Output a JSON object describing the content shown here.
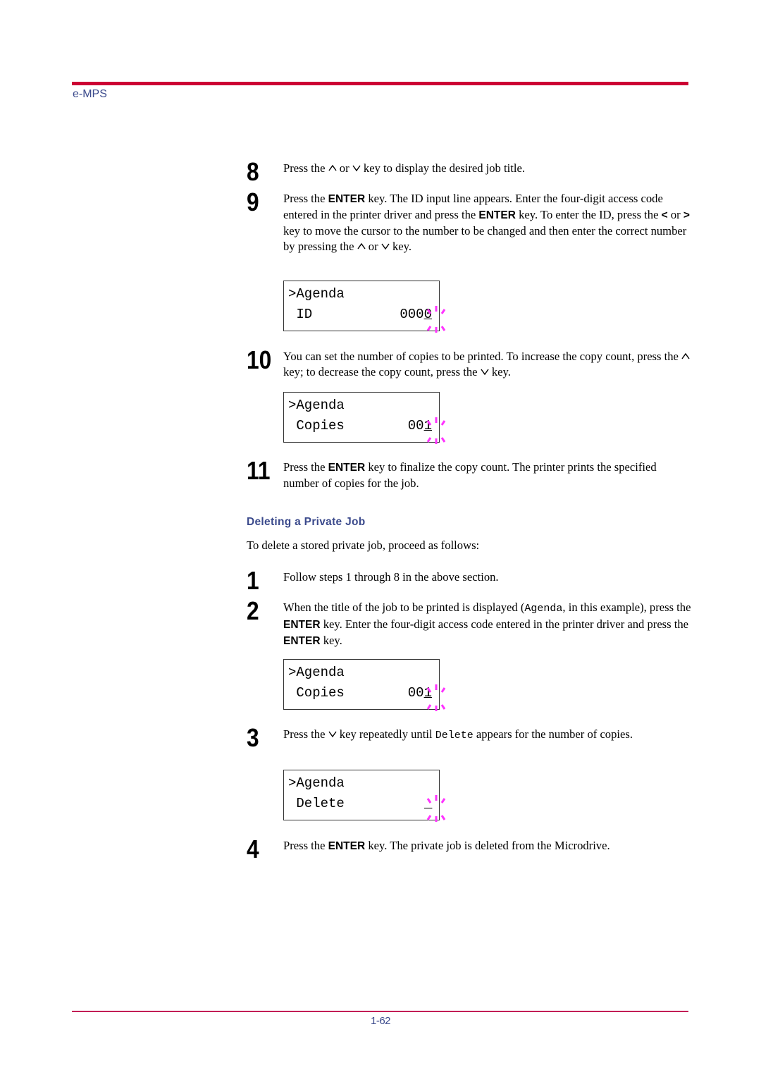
{
  "header": {
    "label": "e-MPS",
    "rule_color": "#cc0033"
  },
  "footer": {
    "page_number": "1-62",
    "rule_color": "#c21e56"
  },
  "colors": {
    "heading": "#3b4a8c",
    "blink_indicator": "#ff33ff"
  },
  "steps_part1": [
    {
      "num": "8",
      "segments": [
        "Press the ",
        {
          "icon": "up-arrow-key"
        },
        " or ",
        {
          "icon": "down-arrow-key"
        },
        " key to display the desired job title."
      ]
    },
    {
      "num": "9"
    },
    {
      "num": "10"
    },
    {
      "num": "11"
    }
  ],
  "step8": {
    "num": "8",
    "t1": "Press the",
    "t2": "or",
    "t3": "key to display the desired job title."
  },
  "step9": {
    "num": "9",
    "t1": "Press the",
    "enter1": "ENTER",
    "t2": "key. The ID input line appears. Enter the four-digit access code entered in the printer driver and press the",
    "enter2": "ENTER",
    "t3": "key. To enter the ID, press the",
    "left": "<",
    "t4": "or",
    "right": ">",
    "t5": "key to move the cursor to the number to be changed and then enter the correct number by pressing the",
    "t6": "or",
    "t7": "key."
  },
  "lcd1": {
    "line1": ">Agenda",
    "line2": " ID",
    "value_prefix": "000",
    "value_cursor": "0"
  },
  "step10": {
    "num": "10",
    "t1": "You can set the number of copies to be printed. To increase the copy count, press the",
    "t2": "key; to decrease the copy count, press the",
    "t3": "key."
  },
  "lcd2": {
    "line1": ">Agenda",
    "line2": " Copies",
    "value_prefix": "00",
    "value_cursor": "1"
  },
  "step11": {
    "num": "11",
    "t1": "Press the",
    "enter": "ENTER",
    "t2": "key to finalize the copy count. The printer prints the specified number of copies for the job."
  },
  "section": {
    "heading": "Deleting a Private Job",
    "intro": "To delete a stored private job, proceed as follows:"
  },
  "del_step1": {
    "num": "1",
    "text": "Follow steps 1 through 8 in the above section."
  },
  "del_step2": {
    "num": "2",
    "t1": "When the title of the job to be printed is displayed (",
    "mono": "Agenda",
    "t2": ", in this example), press the",
    "enter1": "ENTER",
    "t3": "key. Enter the four-digit access code entered in the printer driver and press the",
    "enter2": "ENTER",
    "t4": "key."
  },
  "lcd3": {
    "line1": ">Agenda",
    "line2": " Copies",
    "value_prefix": "00",
    "value_cursor": "1"
  },
  "del_step3": {
    "num": "3",
    "t1": "Press the",
    "t2": "key repeatedly until",
    "mono": "Delete",
    "t3": "appears for the number of copies."
  },
  "lcd4": {
    "line1": ">Agenda",
    "line2": " Delete",
    "value_prefix": "",
    "value_cursor": " "
  },
  "del_step4": {
    "num": "4",
    "t1": "Press the",
    "enter": "ENTER",
    "t2": "key. The private job is deleted from the Microdrive."
  }
}
